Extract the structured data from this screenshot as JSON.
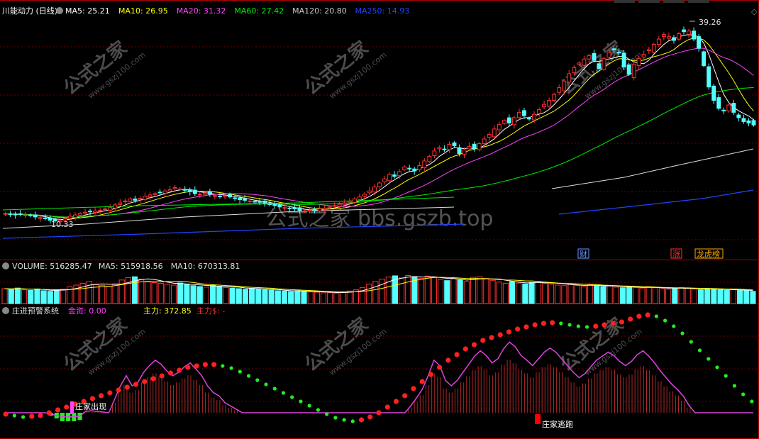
{
  "main_panel": {
    "title": "川能动力 (日线)",
    "ma_labels": [
      {
        "key": "ma5",
        "text": "MA5: 25.21",
        "color": "#ffffff"
      },
      {
        "key": "ma10",
        "text": "MA10: 26.95",
        "color": "#ffff00"
      },
      {
        "key": "ma20",
        "text": "MA20: 31.32",
        "color": "#ff44ff"
      },
      {
        "key": "ma60",
        "text": "MA60: 27.42",
        "color": "#00ee00"
      },
      {
        "key": "ma120",
        "text": "MA120: 20.80",
        "color": "#cccccc"
      },
      {
        "key": "ma250",
        "text": "MA250: 14.93",
        "color": "#2244ff"
      }
    ],
    "high_label": "39.26",
    "low_label": "10.33",
    "event_tags": [
      {
        "text": "财",
        "color": "#6699ff"
      },
      {
        "text": "涨",
        "color": "#ff3333"
      },
      {
        "text": "龙虎榜",
        "color": "#ffaa00"
      }
    ]
  },
  "volume_panel": {
    "labels": [
      {
        "text": "VOLUME: 516285.47",
        "color": "#dddddd"
      },
      {
        "text": "MA5: 515918.56",
        "color": "#dddddd"
      },
      {
        "text": "MA10: 670313.81",
        "color": "#dddddd"
      }
    ]
  },
  "indicator_panel": {
    "title": "庄进预警系统",
    "labels": [
      {
        "text": "金资: 0.00",
        "color": "#ff44ff"
      },
      {
        "text": "主力: 372.85",
        "color": "#ffff00"
      },
      {
        "text": "主力$: -",
        "color": "#ff3333"
      }
    ],
    "signal_in": "庄家出现",
    "signal_out": "庄家逃跑"
  },
  "watermark": {
    "center_text": "公式之家 bbs.gszb.top",
    "stamp_text": "公式之家",
    "stamp_sub": "www.gszj100.com"
  },
  "chart_data": [
    {
      "type": "candlestick",
      "x": [
        1,
        2,
        3,
        4,
        5,
        6,
        7,
        8,
        9,
        10,
        11,
        12,
        13,
        14,
        15,
        16,
        17,
        18,
        19,
        20,
        21,
        22,
        23,
        24,
        25,
        26,
        27,
        28,
        29,
        30,
        31,
        32,
        33,
        34,
        35,
        36,
        37,
        38,
        39,
        40,
        41,
        42,
        43,
        44,
        45,
        46,
        47,
        48,
        49,
        50,
        51,
        52,
        53,
        54,
        55,
        56,
        57,
        58,
        59,
        60,
        61,
        62,
        63,
        64,
        65,
        66,
        67,
        68,
        69,
        70,
        71,
        72,
        73,
        74,
        75,
        76,
        77,
        78,
        79,
        80,
        81,
        82,
        83,
        84,
        85,
        86,
        87,
        88,
        89,
        90,
        91,
        92,
        93,
        94,
        95,
        96,
        97,
        98,
        99,
        100,
        101,
        102,
        103,
        104,
        105,
        106,
        107,
        108,
        109,
        110,
        111,
        112,
        113,
        114,
        115,
        116,
        117,
        118,
        119,
        120,
        121,
        122,
        123,
        124,
        125,
        126,
        127,
        128,
        129,
        130,
        131,
        132,
        133,
        134,
        135,
        136,
        137,
        138,
        139,
        140,
        141,
        142,
        143,
        144,
        145,
        146,
        147,
        148,
        149,
        150,
        151,
        152,
        153,
        154,
        155,
        156,
        157,
        158,
        159,
        160,
        161,
        162,
        163,
        164,
        165,
        166,
        167,
        168,
        169,
        170,
        171,
        172,
        173,
        174,
        175,
        176,
        177,
        178
      ],
      "close": [
        11.6,
        11.5,
        11.4,
        11.5,
        11.4,
        11.3,
        11.1,
        11.0,
        10.9,
        10.6,
        10.5,
        10.6,
        10.8,
        11.2,
        11.4,
        11.6,
        11.8,
        11.9,
        12.0,
        12.1,
        12.3,
        12.5,
        12.9,
        13.2,
        13.5,
        13.8,
        13.6,
        13.9,
        14.2,
        14.4,
        14.6,
        14.8,
        15.0,
        15.2,
        15.5,
        15.3,
        15.1,
        14.9,
        14.6,
        14.5,
        14.7,
        14.5,
        14.3,
        14.2,
        14.3,
        14.1,
        13.9,
        13.7,
        13.6,
        13.5,
        13.4,
        13.3,
        13.2,
        13.0,
        12.8,
        12.6,
        12.5,
        12.4,
        12.3,
        12.1,
        12.0,
        12.1,
        12.2,
        12.3,
        12.4,
        12.6,
        12.8,
        13.0,
        13.2,
        13.5,
        13.8,
        14.1,
        14.5,
        15.0,
        15.6,
        16.2,
        16.8,
        17.5,
        17.2,
        17.9,
        18.6,
        18.3,
        18.0,
        18.8,
        19.5,
        20.2,
        21.0,
        21.5,
        21.2,
        22.0,
        21.8,
        20.6,
        21.2,
        21.7,
        21.4,
        22.1,
        22.8,
        23.5,
        24.3,
        25.0,
        25.6,
        25.2,
        26.0,
        26.8,
        26.3,
        25.8,
        26.5,
        27.2,
        28.0,
        28.6,
        29.5,
        30.5,
        31.5,
        32.6,
        33.5,
        34.2,
        34.8,
        35.3,
        34.6,
        33.4,
        34.9,
        35.8,
        36.2,
        35.7,
        33.6,
        32.5,
        34.0,
        34.9,
        35.5,
        36.2,
        37.0,
        37.8,
        38.5,
        38.2,
        37.6,
        38.6,
        38.9,
        39.0,
        37.8,
        36.4,
        33.8,
        30.6,
        28.6,
        27.4,
        27.0,
        27.9,
        26.8,
        26.0,
        25.4,
        25.2,
        24.9
      ],
      "ma_lines": [
        "MA5",
        "MA10",
        "MA20",
        "MA60",
        "MA120",
        "MA250"
      ],
      "annotations": [
        {
          "text": "39.26",
          "x": 142
        },
        {
          "text": "10.33",
          "x": 10
        }
      ]
    },
    {
      "type": "bar",
      "title": "VOLUME",
      "series": [
        {
          "name": "VOLUME",
          "values": [
            5,
            4.8,
            5.2,
            4.6,
            4.4,
            4.9,
            4.3,
            4.1,
            4.5,
            4.8,
            5.6,
            6.2,
            6.8,
            7.4,
            6.3,
            6.1,
            5.8,
            6.6,
            7.9,
            8.7,
            9.0,
            8.2,
            7.5,
            7.0,
            6.8,
            6.5,
            6.2,
            6.9,
            6.4,
            6.0,
            5.7,
            5.5,
            6.1,
            5.8,
            5.4,
            5.2,
            5.0,
            4.8,
            5.1,
            4.9,
            4.6,
            4.5,
            4.3,
            4.2,
            4.0,
            4.3,
            4.1,
            3.9,
            3.8,
            3.6,
            3.7,
            3.5,
            3.9,
            4.2,
            4.6,
            5.4,
            6.5,
            7.4,
            8.2,
            8.9,
            9.3,
            8.6,
            9.4,
            9.0,
            8.5,
            9.2,
            8.8,
            8.1,
            7.7,
            8.3,
            7.9,
            7.4,
            8.8,
            9.0,
            8.4,
            7.8,
            7.2,
            6.8,
            7.3,
            6.9,
            6.6,
            7.1,
            7.5,
            6.8,
            6.5,
            6.2,
            6.0,
            6.4,
            6.1,
            5.8,
            6.3,
            6.0,
            5.7,
            5.9,
            5.5,
            5.3,
            5.6,
            5.4,
            5.2,
            5.5,
            5.3,
            5.0,
            4.8,
            5.2,
            5.4,
            5.1,
            4.9,
            4.7,
            5.0,
            4.8,
            4.6,
            4.4,
            4.7,
            4.5,
            4.3,
            4.1
          ]
        }
      ],
      "annotations": [
        "MA5",
        "MA10"
      ]
    },
    {
      "type": "line",
      "title": "庄进预警系统",
      "series": [
        {
          "name": "主力",
          "values": [
            0,
            0,
            0,
            0,
            0,
            0,
            0,
            0,
            -2,
            -4,
            -6,
            -6,
            -6,
            -5,
            2,
            3,
            2,
            1,
            0,
            20,
            40,
            55,
            40,
            45,
            60,
            70,
            78,
            72,
            62,
            55,
            60,
            68,
            74,
            65,
            55,
            40,
            30,
            25,
            15,
            10,
            5,
            0,
            0,
            0,
            0,
            0,
            0,
            0,
            0,
            0,
            0,
            0,
            0,
            0,
            0,
            0,
            0,
            0,
            0,
            0,
            0,
            0,
            0,
            0,
            0,
            0,
            0,
            0,
            0,
            0,
            10,
            22,
            35,
            55,
            78,
            70,
            48,
            40,
            48,
            60,
            72,
            84,
            92,
            85,
            74,
            80,
            95,
            105,
            98,
            85,
            78,
            70,
            80,
            90,
            96,
            90,
            80,
            70,
            60,
            52,
            58,
            68,
            78,
            84,
            90,
            85,
            76,
            70,
            76,
            86,
            92,
            84,
            74,
            62,
            52,
            42,
            34,
            24,
            10,
            0,
            0,
            0,
            0,
            0,
            0,
            0,
            0,
            0,
            0,
            0
          ]
        },
        {
          "name": "金资",
          "values": [
            -10,
            -12,
            -14,
            -13,
            -12,
            -8,
            -4,
            0,
            4,
            8,
            12,
            16,
            20,
            24,
            28,
            32,
            36,
            40,
            44,
            48,
            52,
            56,
            58,
            60,
            60,
            58,
            55,
            50,
            44,
            38,
            32,
            26,
            20,
            14,
            8,
            2,
            -4,
            -10,
            -15,
            -18,
            -20,
            -18,
            -14,
            -8,
            0,
            8,
            16,
            26,
            36,
            46,
            56,
            66,
            74,
            82,
            88,
            94,
            98,
            102,
            106,
            110,
            113,
            116,
            118,
            119,
            118,
            116,
            114,
            113,
            114,
            116,
            118,
            120,
            124,
            128,
            130,
            128,
            122,
            114,
            104,
            92,
            80,
            68,
            56,
            44,
            30,
            18,
            8
          ]
        }
      ],
      "annotations": [
        "庄家出现",
        "庄家逃跑"
      ]
    }
  ]
}
